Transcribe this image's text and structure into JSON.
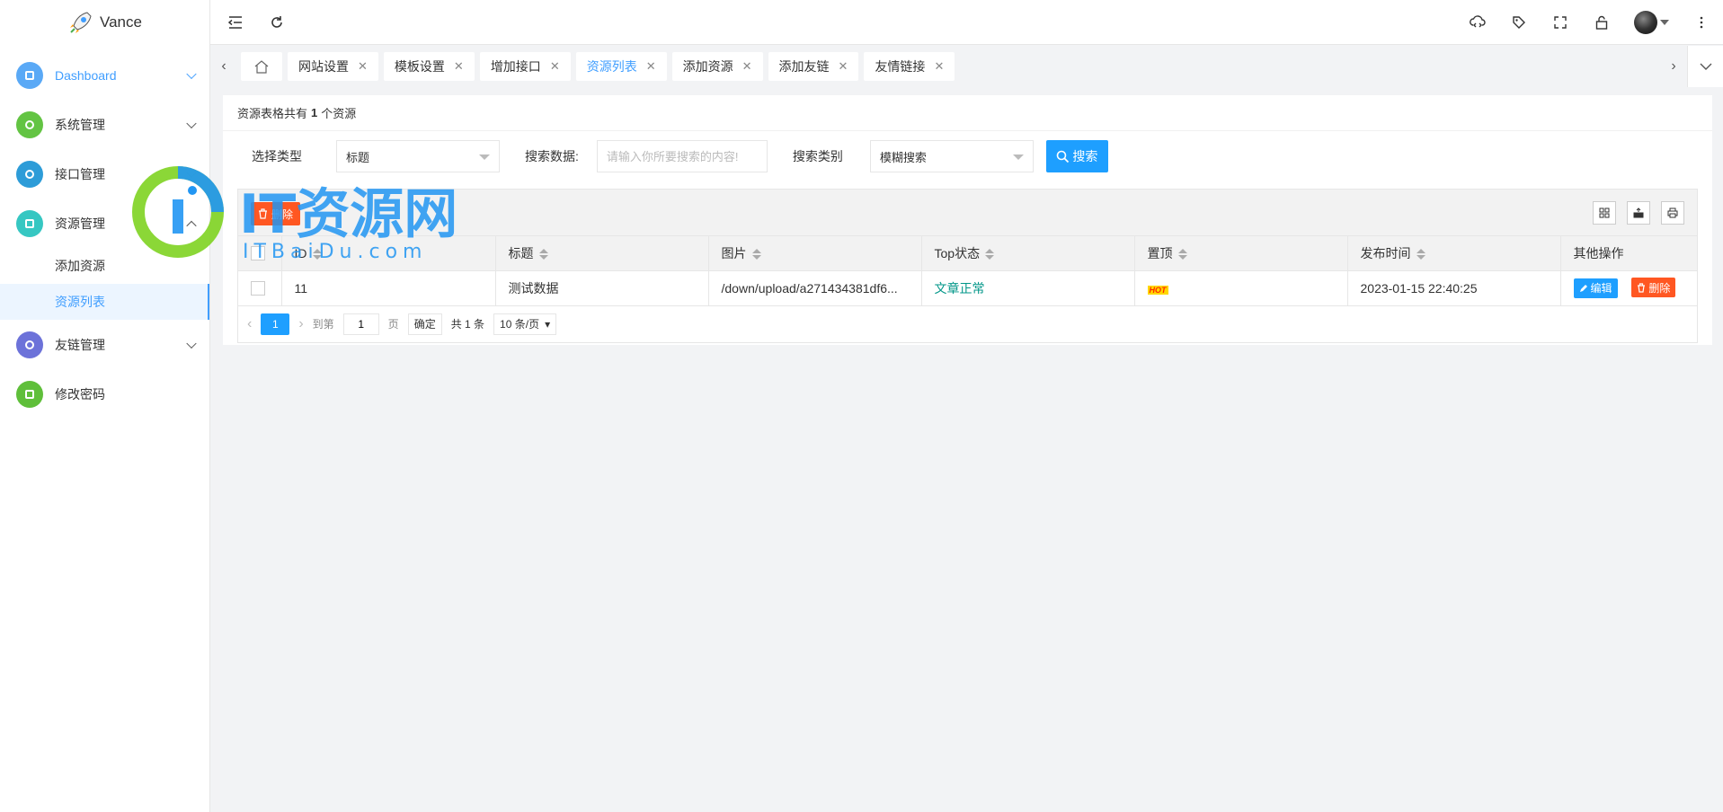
{
  "app": {
    "name": "Vance"
  },
  "sidebar": {
    "items": [
      {
        "label": "Dashboard",
        "color": "#5aa9f6",
        "active": true,
        "expanded": false
      },
      {
        "label": "系统管理",
        "color": "#63c443"
      },
      {
        "label": "接口管理",
        "color": "#2d9cd8"
      },
      {
        "label": "资源管理",
        "color": "#36c7c2",
        "expanded": true
      },
      {
        "label": "友链管理",
        "color": "#6c72d9"
      },
      {
        "label": "修改密码",
        "color": "#5fbf3a"
      }
    ],
    "submenu": [
      {
        "label": "添加资源"
      },
      {
        "label": "资源列表",
        "active": true
      }
    ]
  },
  "tabs": [
    {
      "label": "网站设置"
    },
    {
      "label": "模板设置"
    },
    {
      "label": "增加接口"
    },
    {
      "label": "资源列表",
      "active": true
    },
    {
      "label": "添加资源"
    },
    {
      "label": "添加友链"
    },
    {
      "label": "友情链接"
    }
  ],
  "content": {
    "title_prefix": "资源表格共有",
    "title_count": "1",
    "title_suffix": "个资源"
  },
  "filters": {
    "type_label": "选择类型",
    "type_value": "标题",
    "data_label": "搜索数据:",
    "data_placeholder": "请输入你所要搜索的内容!",
    "category_label": "搜索类别",
    "category_value": "模糊搜索",
    "search_button": "搜索"
  },
  "toolbar": {
    "delete_label": "删除"
  },
  "table": {
    "headers": [
      "ID",
      "标题",
      "图片",
      "Top状态",
      "置顶",
      "发布时间",
      "其他操作"
    ],
    "rows": [
      {
        "id": "11",
        "title": "测试数据",
        "image": "/down/upload/a271434381df6...",
        "status": "文章正常",
        "pin": "HOT",
        "date": "2023-01-15 22:40:25",
        "edit": "编辑",
        "delete": "删除"
      }
    ]
  },
  "pager": {
    "current": "1",
    "goto_label": "到第",
    "goto_value": "1",
    "page_label": "页",
    "confirm": "确定",
    "total": "共 1 条",
    "size": "10 条/页"
  },
  "watermark": {
    "text": "IT资源网",
    "sub": "ITBaiDu.com"
  },
  "colors": {
    "primary": "#1e9fff",
    "danger": "#ff5722",
    "success": "#009688"
  }
}
